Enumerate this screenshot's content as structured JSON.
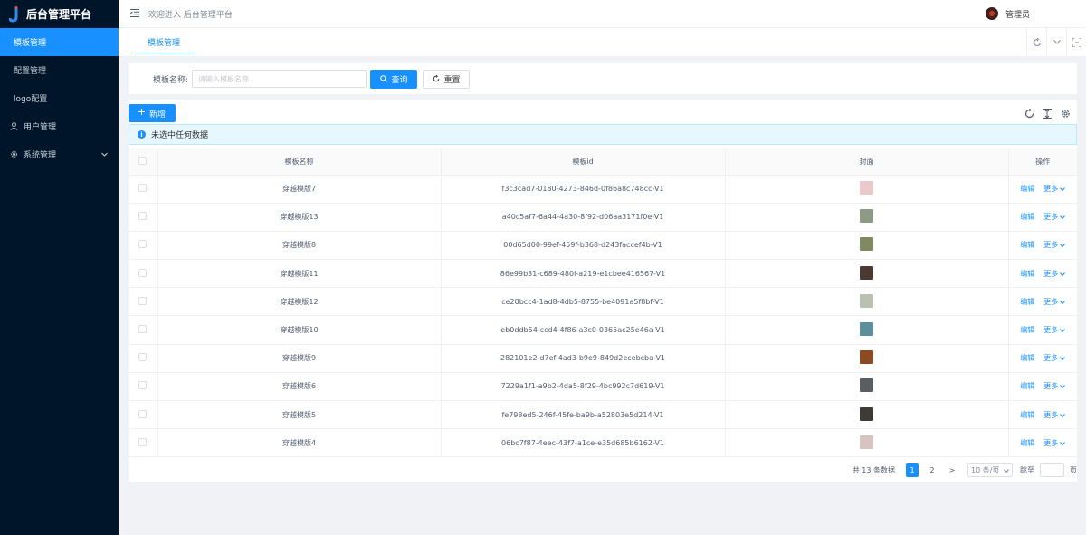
{
  "app": {
    "title": "后台管理平台"
  },
  "sidebar": {
    "items": [
      {
        "label": "模板管理",
        "active": true
      },
      {
        "label": "配置管理",
        "active": false
      },
      {
        "label": "logo配置",
        "active": false
      },
      {
        "label": "用户管理",
        "active": false,
        "icon": "user-icon"
      },
      {
        "label": "系统管理",
        "active": false,
        "icon": "gear-icon",
        "expandable": true
      }
    ]
  },
  "header": {
    "welcome": "欢迎进入 后台管理平台",
    "username": "管理员"
  },
  "tabs": [
    {
      "label": "模板管理",
      "active": true
    }
  ],
  "search": {
    "label": "模板名称:",
    "placeholder": "请输入模板名称",
    "value": "",
    "query_label": "查询",
    "reset_label": "重置"
  },
  "toolbar": {
    "add_label": "新增"
  },
  "alert": {
    "text": "未选中任何数据"
  },
  "table": {
    "columns": [
      "模板名称",
      "模板id",
      "封面",
      "操作"
    ],
    "rows": [
      {
        "name": "穿越模版7",
        "id": "f3c3cad7-0180-4273-846d-0f86a8c748cc-V1",
        "cover": "#e9c9c9"
      },
      {
        "name": "穿越模版13",
        "id": "a40c5af7-6a44-4a30-8f92-d06aa3171f0e-V1",
        "cover": "#8d9a85"
      },
      {
        "name": "穿越模版8",
        "id": "00d65d00-99ef-459f-b368-d243faccef4b-V1",
        "cover": "#7f8a62"
      },
      {
        "name": "穿越模版11",
        "id": "86e99b31-c689-480f-a219-e1cbee416567-V1",
        "cover": "#4a3a33"
      },
      {
        "name": "穿越模版12",
        "id": "ce20bcc4-1ad8-4db5-8755-be4091a5f8bf-V1",
        "cover": "#b9c2b2"
      },
      {
        "name": "穿越模版10",
        "id": "eb0ddb54-ccd4-4f86-a3c0-0365ac25e46a-V1",
        "cover": "#5d8e9b"
      },
      {
        "name": "穿越模版9",
        "id": "282101e2-d7ef-4ad3-b9e9-849d2ecebcba-V1",
        "cover": "#8a4a24"
      },
      {
        "name": "穿越模版6",
        "id": "7229a1f1-a9b2-4da5-8f29-4bc992c7d619-V1",
        "cover": "#5a5e60"
      },
      {
        "name": "穿越模版5",
        "id": "fe798ed5-246f-45fe-ba9b-a52803e5d214-V1",
        "cover": "#3e3a36"
      },
      {
        "name": "穿越模版4",
        "id": "06bc7f87-4eec-43f7-a1ce-e35d685b6162-V1",
        "cover": "#d7c4c0"
      }
    ],
    "edit_label": "编辑",
    "more_label": "更多"
  },
  "pagination": {
    "total_text": "共 13 条数据",
    "pages": [
      "1",
      "2"
    ],
    "current": "1",
    "next_symbol": ">",
    "page_size": "10 条/页",
    "jump_label": "跳至",
    "page_suffix": "页"
  },
  "colors": {
    "primary": "#1890ff",
    "sidebar_bg": "#001529"
  }
}
